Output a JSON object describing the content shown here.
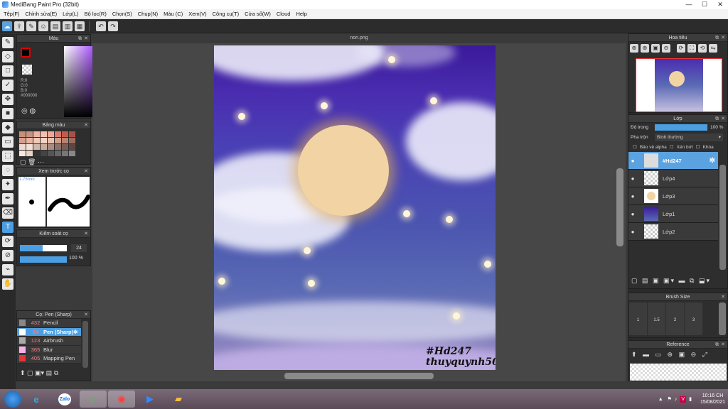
{
  "window": {
    "title": "MediBang Paint Pro (32bit)",
    "minimize": "—",
    "maximize": "☐",
    "close": "✕"
  },
  "menu": [
    "Tệp(F)",
    "Chỉnh sửa(E)",
    "Lớp(L)",
    "Bộ lọc(R)",
    "Chọn(S)",
    "Chụp(N)",
    "Màu (C)",
    "Xem(V)",
    "Công cụ(T)",
    "Cửa sổ(W)",
    "Cloud",
    "Help"
  ],
  "document": {
    "tab": "non.png",
    "signature_line1": "#Hd247",
    "signature_line2": "thuyquynh50"
  },
  "color_panel": {
    "title": "Màu",
    "r": "R:0",
    "g": "G:0",
    "b": "B:0",
    "hex": "#000000"
  },
  "swatch_panel": {
    "title": "Bảng màu",
    "swatches": [
      "#c98f7d",
      "#c59383",
      "#f0b4a0",
      "#f4c0ae",
      "#eaa899",
      "#d57b6f",
      "#c55b4a",
      "#a65247",
      "#d9a090",
      "#e7b6a2",
      "#f2c9b7",
      "#f4d3c4",
      "#e8c0ae",
      "#cf9d8a",
      "#b98371",
      "#9e6b5b",
      "#f0d8cc",
      "#f2e2d6",
      "#d2b7a7",
      "#c8ab9c",
      "#a98b80",
      "#8d7066",
      "#7c5c52",
      "#5f463e",
      "#f7e8e0",
      "#e9d3c7",
      "#333333",
      "#444444",
      "#555555",
      "#666666",
      "#777777",
      "#888888"
    ]
  },
  "brush_preview": {
    "title": "Xem trước cọ",
    "size": "1.75mm"
  },
  "brush_control": {
    "title": "Kiểm soát cọ",
    "size_value": "24",
    "opacity_value": "100 %"
  },
  "brush_list": {
    "title": "Cọ: Pen (Sharp)",
    "items": [
      {
        "num": "432",
        "name": "Pencil",
        "color": "#888888"
      },
      {
        "num": "24",
        "name": "Pen (Sharp)",
        "color": "#ffffff"
      },
      {
        "num": "123",
        "name": "Airbrush",
        "color": "#aaaaaa"
      },
      {
        "num": "365",
        "name": "Blur",
        "color": "#f7b3e8"
      },
      {
        "num": "405",
        "name": "Mapping Pen",
        "color": "#e8333a"
      }
    ]
  },
  "navigator": {
    "title": "Hoa tiêu"
  },
  "layers_panel": {
    "title": "Lớp",
    "opacity_label": "Độ trong",
    "opacity_value": "100 %",
    "blend_label": "Pha trộn",
    "blend_value": "Bình thường",
    "protect_alpha": "Bảo vệ alpha",
    "clipping": "Xén bớt",
    "lock": "Khóa",
    "layers": [
      {
        "name": "#Hd247",
        "selected": true
      },
      {
        "name": "Lớp4",
        "selected": false
      },
      {
        "name": "Lớp3",
        "selected": false
      },
      {
        "name": "Lớp1",
        "selected": false
      },
      {
        "name": "Lớp2",
        "selected": false
      }
    ]
  },
  "brush_size_panel": {
    "title": "Brush Size",
    "sizes": [
      "1",
      "1.5",
      "2",
      "3"
    ]
  },
  "reference_panel": {
    "title": "Reference"
  },
  "taskbar": {
    "time": "10:16 CH",
    "date": "15/08/2021",
    "zalo": "Zalo"
  }
}
